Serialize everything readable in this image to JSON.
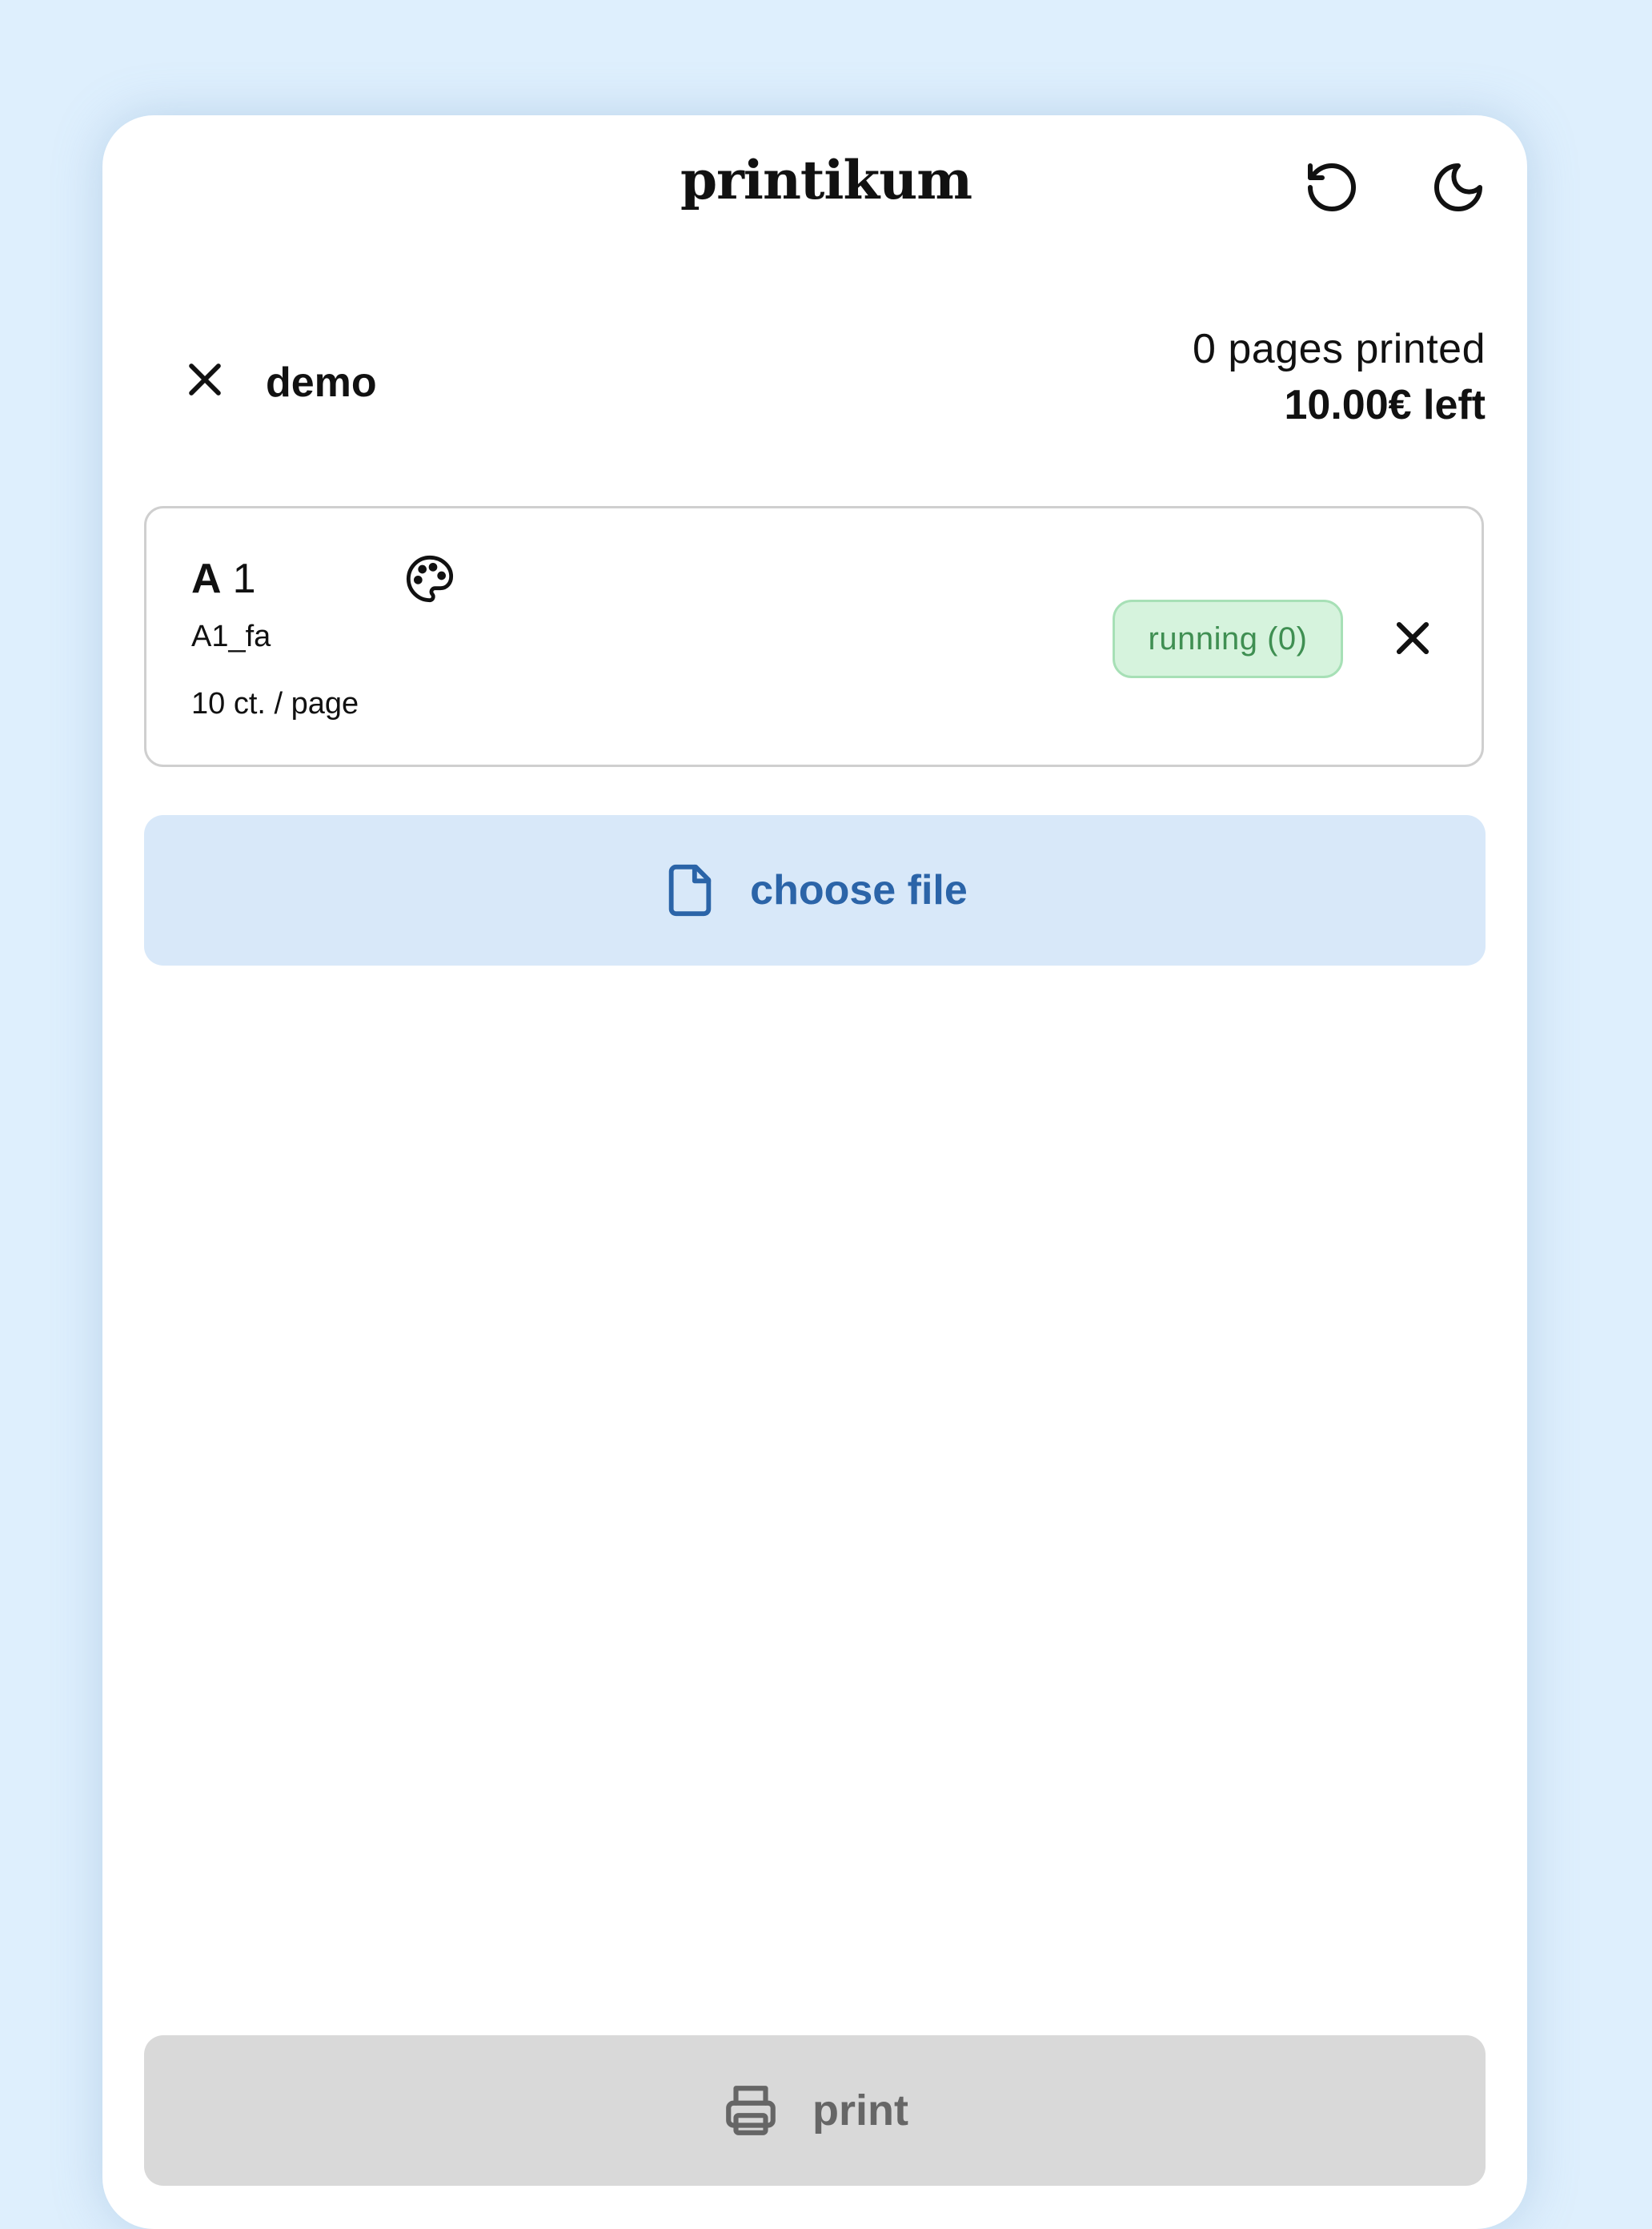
{
  "header": {
    "brand": "printikum",
    "reset_icon": "rotate-ccw-icon",
    "theme_icon": "moon-icon"
  },
  "user": {
    "name": "demo",
    "pages_printed": "0 pages printed",
    "balance": "10.00€ left"
  },
  "printers": [
    {
      "letter": "A",
      "number": "1",
      "queue": "A1_fa",
      "price": "10 ct. / page",
      "status": "running (0)",
      "color_icon": "palette-icon"
    }
  ],
  "actions": {
    "choose_file_label": "choose file",
    "print_label": "print"
  },
  "colors": {
    "background": "#deeffd",
    "status_running_bg": "#d6f3dd",
    "status_running_text": "#3f8f52",
    "primary_soft": "#d8e8f9",
    "primary_text": "#2b64a8",
    "disabled_bg": "#d9d9d9"
  }
}
